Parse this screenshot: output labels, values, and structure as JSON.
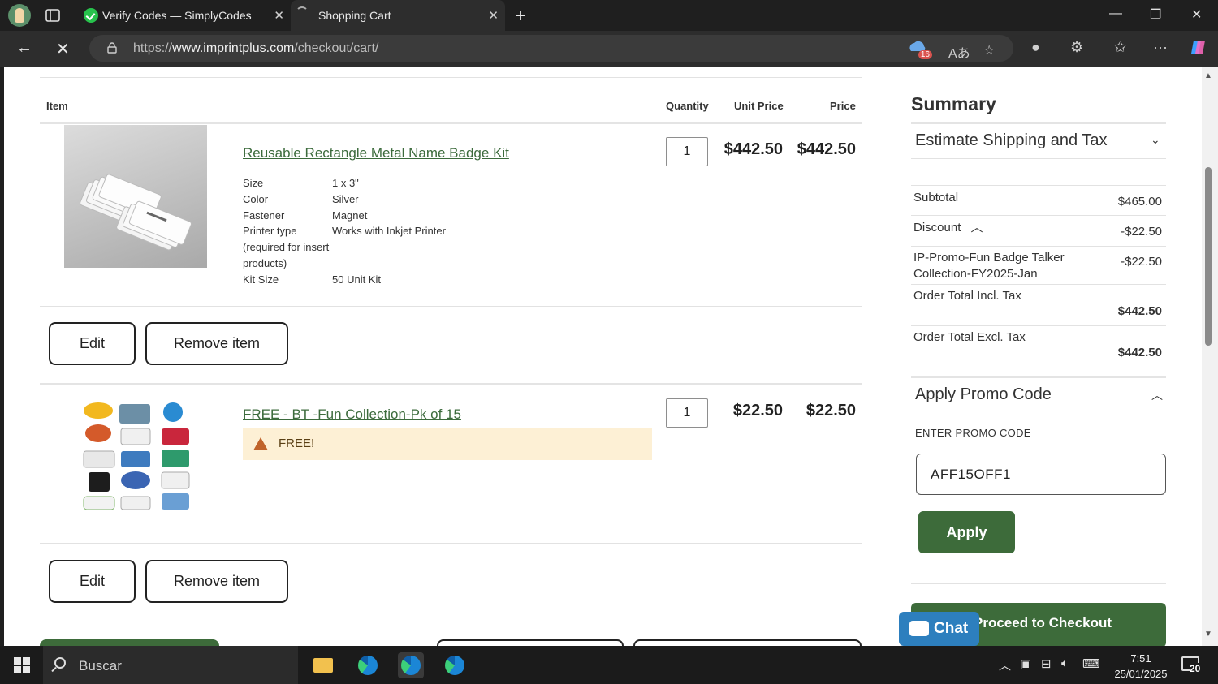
{
  "browser": {
    "tabs": [
      {
        "title": "Verify Codes — SimplyCodes",
        "close": "✕"
      },
      {
        "title": "Shopping Cart",
        "close": "✕"
      }
    ],
    "new_tab": "+",
    "window_controls": [
      "—",
      "❐",
      "✕"
    ],
    "url_prefix": "https://",
    "url_domain": "www.imprintplus.com",
    "url_path": "/checkout/cart/",
    "extension_badge": "16"
  },
  "cart": {
    "headers": {
      "item": "Item",
      "quantity": "Quantity",
      "unit_price": "Unit Price",
      "price": "Price"
    },
    "items": [
      {
        "name": "Reusable Rectangle Metal Name Badge Kit",
        "quantity": "1",
        "unit_price": "$442.50",
        "price": "$442.50",
        "options": [
          {
            "label": "Size",
            "value": "1 x 3\""
          },
          {
            "label": "Color",
            "value": "Silver"
          },
          {
            "label": "Fastener",
            "value": "Magnet"
          },
          {
            "label": "Printer type (required for insert products)",
            "value": "Works with Inkjet Printer"
          },
          {
            "label": "Kit Size",
            "value": "50 Unit Kit"
          }
        ],
        "edit_label": "Edit",
        "remove_label": "Remove item"
      },
      {
        "name": "FREE - BT -Fun Collection-Pk of 15",
        "quantity": "1",
        "unit_price": "$22.50",
        "price": "$22.50",
        "notice": "FREE!",
        "edit_label": "Edit",
        "remove_label": "Remove item"
      }
    ]
  },
  "summary": {
    "title": "Summary",
    "estimate_label": "Estimate Shipping and Tax",
    "subtotal_label": "Subtotal",
    "subtotal": "$465.00",
    "discount_label": "Discount",
    "discount": "-$22.50",
    "promo_line_label": "IP-Promo-Fun Badge Talker Collection-FY2025-Jan",
    "promo_line_value": "-$22.50",
    "total_incl_label": "Order Total Incl. Tax",
    "total_incl": "$442.50",
    "total_excl_label": "Order Total Excl. Tax",
    "total_excl": "$442.50",
    "apply_promo_label": "Apply Promo Code",
    "enter_promo_label": "ENTER PROMO CODE",
    "promo_value": "AFF15OFF1",
    "apply_button": "Apply",
    "checkout_button": "Proceed to Checkout",
    "chat_label": "Chat"
  },
  "taskbar": {
    "search_placeholder": "Buscar",
    "time": "7:51",
    "date": "25/01/2025",
    "notifications": "20"
  },
  "colors": {
    "brand_green": "#3d6b3a",
    "link_green": "#3c6b3c",
    "chat_blue": "#2d7fbe",
    "free_bg": "#fdf0d5"
  }
}
